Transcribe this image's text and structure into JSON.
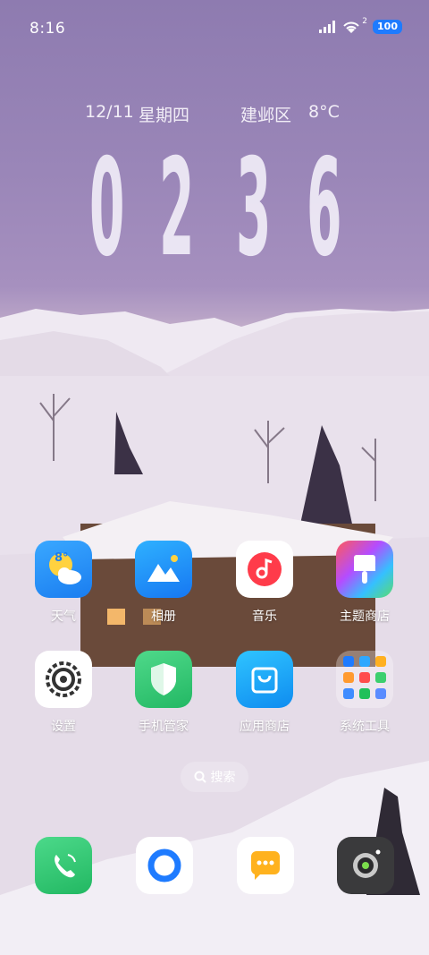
{
  "status_bar": {
    "time": "8:16",
    "signal_sup": "2",
    "battery": "100"
  },
  "lock_info": {
    "date": "12/11",
    "weekday": "星期四",
    "location": "建邺区",
    "temperature": "8°C"
  },
  "clock": {
    "digits": [
      "0",
      "2",
      "3",
      "6"
    ]
  },
  "weather_icon": {
    "temp": "8°"
  },
  "apps_row1": [
    {
      "label": "天气",
      "icon": "weather-icon"
    },
    {
      "label": "相册",
      "icon": "gallery-icon"
    },
    {
      "label": "音乐",
      "icon": "music-icon"
    },
    {
      "label": "主题商店",
      "icon": "theme-store-icon"
    }
  ],
  "apps_row2": [
    {
      "label": "设置",
      "icon": "settings-icon"
    },
    {
      "label": "手机管家",
      "icon": "security-shield-icon"
    },
    {
      "label": "应用商店",
      "icon": "app-store-icon"
    },
    {
      "label": "系统工具",
      "icon": "folder-icon"
    }
  ],
  "search": {
    "label": "搜索"
  },
  "dock": [
    {
      "icon": "phone-icon"
    },
    {
      "icon": "browser-icon"
    },
    {
      "icon": "messages-icon"
    },
    {
      "icon": "camera-icon"
    }
  ]
}
